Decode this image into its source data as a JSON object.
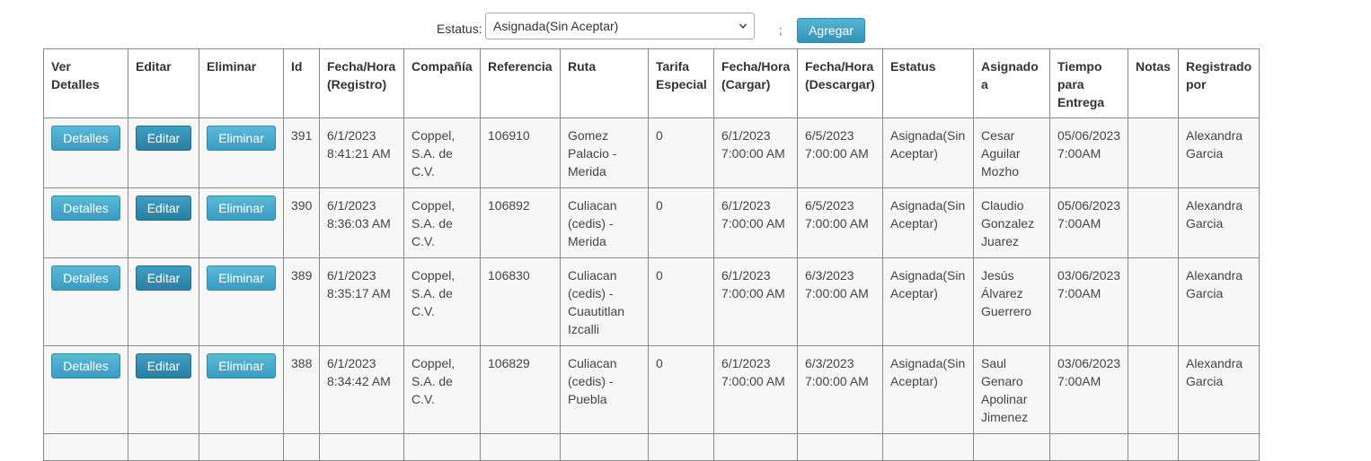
{
  "filter": {
    "label": "Estatus:",
    "selected": "Asignada(Sin Aceptar)",
    "separator": ";",
    "add_label": "Agregar"
  },
  "table": {
    "headers": [
      "Ver Detalles",
      "Editar",
      "Eliminar",
      "Id",
      "Fecha/Hora (Registro)",
      "Compañía",
      "Referencia",
      "Ruta",
      "Tarifa Especial",
      "Fecha/Hora (Cargar)",
      "Fecha/Hora (Descargar)",
      "Estatus",
      "Asignado a",
      "Tiempo para Entrega",
      "Notas",
      "Registrado por"
    ],
    "button_labels": {
      "details": "Detalles",
      "edit": "Editar",
      "delete": "Eliminar"
    },
    "rows": [
      {
        "id": "391",
        "registro": "6/1/2023 8:41:21 AM",
        "compania": "Coppel, S.A. de C.V.",
        "referencia": "106910",
        "ruta": "Gomez Palacio - Merida",
        "tarifa": "0",
        "cargar": "6/1/2023 7:00:00 AM",
        "descargar": "6/5/2023 7:00:00 AM",
        "estatus": "Asignada(Sin Aceptar)",
        "asignado": "Cesar Aguilar Mozho",
        "tiempo": "05/06/2023 7:00AM",
        "notas": "",
        "registrado": "Alexandra Garcia"
      },
      {
        "id": "390",
        "registro": "6/1/2023 8:36:03 AM",
        "compania": "Coppel, S.A. de C.V.",
        "referencia": "106892",
        "ruta": "Culiacan (cedis) - Merida",
        "tarifa": "0",
        "cargar": "6/1/2023 7:00:00 AM",
        "descargar": "6/5/2023 7:00:00 AM",
        "estatus": "Asignada(Sin Aceptar)",
        "asignado": "Claudio Gonzalez Juarez",
        "tiempo": "05/06/2023 7:00AM",
        "notas": "",
        "registrado": "Alexandra Garcia"
      },
      {
        "id": "389",
        "registro": "6/1/2023 8:35:17 AM",
        "compania": "Coppel, S.A. de C.V.",
        "referencia": "106830",
        "ruta": "Culiacan (cedis) - Cuautitlan Izcalli",
        "tarifa": "0",
        "cargar": "6/1/2023 7:00:00 AM",
        "descargar": "6/3/2023 7:00:00 AM",
        "estatus": "Asignada(Sin Aceptar)",
        "asignado": "Jesús Álvarez Guerrero",
        "tiempo": "03/06/2023 7:00AM",
        "notas": "",
        "registrado": "Alexandra Garcia"
      },
      {
        "id": "388",
        "registro": "6/1/2023 8:34:42 AM",
        "compania": "Coppel, S.A. de C.V.",
        "referencia": "106829",
        "ruta": "Culiacan (cedis) - Puebla",
        "tarifa": "0",
        "cargar": "6/1/2023 7:00:00 AM",
        "descargar": "6/3/2023 7:00:00 AM",
        "estatus": "Asignada(Sin Aceptar)",
        "asignado": "Saul Genaro Apolinar Jimenez",
        "tiempo": "03/06/2023 7:00AM",
        "notas": "",
        "registrado": "Alexandra Garcia"
      }
    ]
  }
}
